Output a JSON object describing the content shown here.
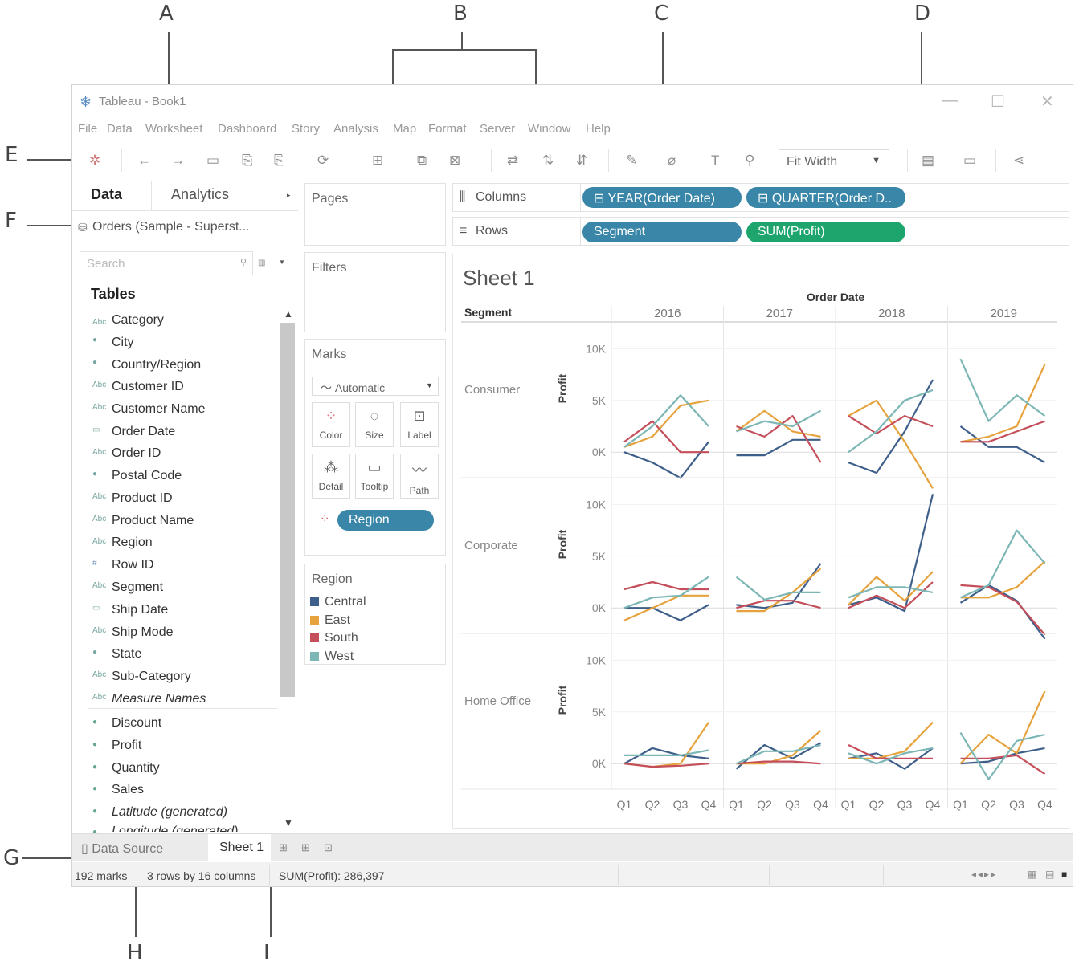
{
  "callouts": {
    "a": "A",
    "b": "B",
    "c": "C",
    "d": "D",
    "e": "E",
    "f": "F",
    "g": "G",
    "h": "H",
    "i": "I"
  },
  "window": {
    "title": "Tableau - Book1",
    "menu": [
      "File",
      "Data",
      "Worksheet",
      "Dashboard",
      "Story",
      "Analysis",
      "Map",
      "Format",
      "Server",
      "Window",
      "Help"
    ],
    "fit": "Fit Width"
  },
  "data_pane": {
    "tab_data": "Data",
    "tab_analytics": "Analytics",
    "datasource": "Orders (Sample - Superst...",
    "search_placeholder": "Search",
    "tables_heading": "Tables",
    "dimensions": [
      "Category",
      "City",
      "Country/Region",
      "Customer ID",
      "Customer Name",
      "Order Date",
      "Order ID",
      "Postal Code",
      "Product ID",
      "Product Name",
      "Region",
      "Row ID",
      "Segment",
      "Ship Date",
      "Ship Mode",
      "State",
      "Sub-Category",
      "Measure Names"
    ],
    "measures": [
      "Discount",
      "Profit",
      "Quantity",
      "Sales",
      "Latitude (generated)",
      "Longitude (generated)"
    ]
  },
  "shelves": {
    "pages": "Pages",
    "filters": "Filters",
    "marks": "Marks",
    "mark_type": "Automatic",
    "mark_buttons": [
      "Color",
      "Size",
      "Label",
      "Detail",
      "Tooltip",
      "Path"
    ],
    "region_pill": "Region",
    "columns_label": "Columns",
    "rows_label": "Rows",
    "columns_pills": [
      "YEAR(Order Date)",
      "QUARTER(Order D.."
    ],
    "rows_pills": [
      "Segment",
      "SUM(Profit)"
    ]
  },
  "legend": {
    "title": "Region",
    "items": [
      {
        "label": "Central",
        "color": "#3e5f8a"
      },
      {
        "label": "East",
        "color": "#e6a23c"
      },
      {
        "label": "South",
        "color": "#c44e5a"
      },
      {
        "label": "West",
        "color": "#7db7b5"
      }
    ]
  },
  "sheet": {
    "title": "Sheet 1",
    "segment_header": "Segment",
    "order_date_header": "Order Date",
    "profit_label": "Profit"
  },
  "chart_data": {
    "type": "line",
    "years": [
      "2016",
      "2017",
      "2018",
      "2019"
    ],
    "quarters": [
      "Q1",
      "Q2",
      "Q3",
      "Q4"
    ],
    "segments": [
      "Consumer",
      "Corporate",
      "Home Office"
    ],
    "yticks": [
      "10K",
      "5K",
      "0K"
    ],
    "ylim": [
      -2000,
      11500
    ],
    "series": [
      {
        "name": "Central",
        "values": {
          "Consumer": [
            [
              0,
              -1000,
              -2500,
              1000
            ],
            [
              -300,
              -300,
              1200,
              1200
            ],
            [
              -1000,
              -2000,
              2000,
              7000
            ],
            [
              2500,
              500,
              500,
              -1000
            ]
          ],
          "Corporate": [
            [
              0,
              0,
              -1200,
              300
            ],
            [
              300,
              0,
              500,
              4300
            ],
            [
              300,
              1000,
              -300,
              11000
            ],
            [
              500,
              2200,
              700,
              -3000
            ]
          ],
          "Home Office": [
            [
              0,
              1500,
              800,
              500
            ],
            [
              -500,
              1800,
              500,
              2000
            ],
            [
              500,
              1000,
              -500,
              1500
            ],
            [
              0,
              200,
              1000,
              1500
            ]
          ]
        }
      },
      {
        "name": "East",
        "values": {
          "Consumer": [
            [
              500,
              1500,
              4500,
              5000
            ],
            [
              2000,
              4000,
              2000,
              1500
            ],
            [
              3500,
              5000,
              1000,
              -3500
            ],
            [
              1000,
              1500,
              2500,
              8500
            ]
          ],
          "Corporate": [
            [
              -1200,
              0,
              1200,
              1200
            ],
            [
              -300,
              -300,
              1500,
              3800
            ],
            [
              300,
              3000,
              700,
              3500
            ],
            [
              1000,
              1000,
              2000,
              4500
            ]
          ],
          "Home Office": [
            [
              0,
              -300,
              0,
              4000
            ],
            [
              0,
              0,
              800,
              3200
            ],
            [
              500,
              500,
              1200,
              4000
            ],
            [
              0,
              2800,
              1000,
              7000
            ]
          ]
        }
      },
      {
        "name": "South",
        "values": {
          "Consumer": [
            [
              1000,
              3000,
              0,
              0
            ],
            [
              2500,
              1500,
              3500,
              -1000
            ],
            [
              3500,
              1800,
              3500,
              2500
            ],
            [
              1000,
              1000,
              2000,
              3000
            ]
          ],
          "Corporate": [
            [
              1800,
              2500,
              1800,
              1800
            ],
            [
              0,
              700,
              700,
              0
            ],
            [
              0,
              1200,
              0,
              2500
            ],
            [
              2200,
              2000,
              600,
              -2600
            ]
          ],
          "Home Office": [
            [
              0,
              -300,
              -200,
              0
            ],
            [
              0,
              200,
              200,
              0
            ],
            [
              1800,
              500,
              500,
              500
            ],
            [
              500,
              500,
              800,
              -1000
            ]
          ]
        }
      },
      {
        "name": "West",
        "values": {
          "Consumer": [
            [
              500,
              2500,
              5500,
              2500
            ],
            [
              2000,
              3000,
              2500,
              4000
            ],
            [
              0,
              2000,
              5000,
              6000
            ],
            [
              9000,
              3000,
              5500,
              3500
            ]
          ],
          "Corporate": [
            [
              0,
              1000,
              1200,
              3000
            ],
            [
              3000,
              800,
              1500,
              1500
            ],
            [
              1000,
              2000,
              2000,
              1500
            ],
            [
              1000,
              2200,
              7500,
              4300
            ]
          ],
          "Home Office": [
            [
              800,
              800,
              800,
              1300
            ],
            [
              0,
              1200,
              1200,
              1800
            ],
            [
              1000,
              0,
              1000,
              1500
            ],
            [
              3000,
              -1500,
              2200,
              2800
            ]
          ]
        }
      }
    ]
  },
  "tabs": {
    "data_source": "Data Source",
    "sheet": "Sheet 1"
  },
  "status": {
    "marks": "192 marks",
    "dims": "3 rows by 16 columns",
    "sum": "SUM(Profit): 286,397"
  }
}
